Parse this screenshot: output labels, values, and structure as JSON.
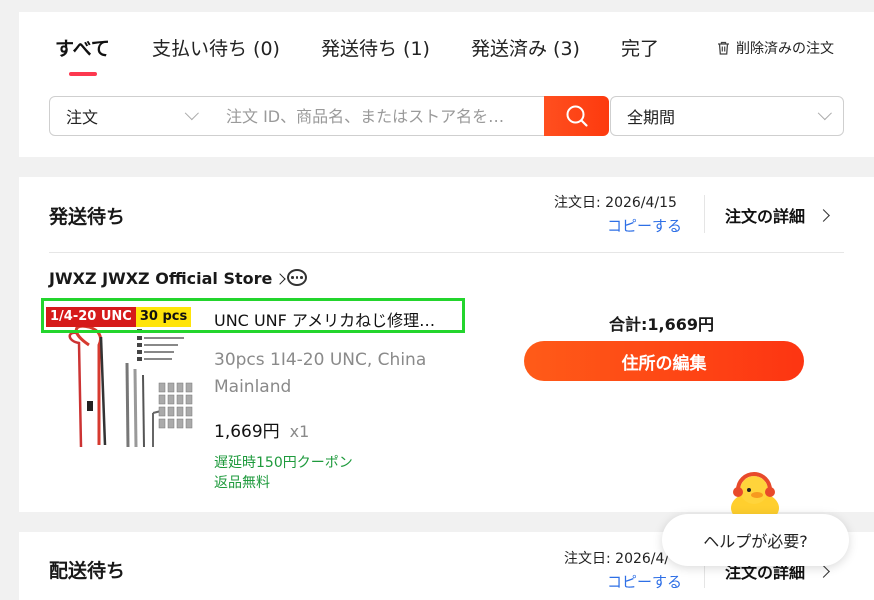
{
  "tabs": [
    {
      "label": "すべて"
    },
    {
      "label": "支払い待ち (0)"
    },
    {
      "label": "発送待ち (1)"
    },
    {
      "label": "発送済み (3)"
    },
    {
      "label": "完了"
    }
  ],
  "deleted_orders_label": "削除済みの注文",
  "search": {
    "type_value": "注文",
    "placeholder": "注文 ID、商品名、またはストア名を…",
    "period_value": "全期間"
  },
  "orders": [
    {
      "status": "発送待ち",
      "order_date": "注文日: 2026/4/15",
      "copy_label": "コピーする",
      "detail_label": "注文の詳細",
      "store_name": "JWXZ JWXZ Official Store",
      "product": {
        "badge_primary": "1/4-20 UNC",
        "badge_secondary": "30 pcs",
        "title": "UNC UNF アメリカねじ修理…",
        "variant": "30pcs 1I4-20 UNC, China Mainland",
        "price": "1,669円",
        "quantity": "x1",
        "perks": [
          "遅延時150円クーポン",
          "返品無料"
        ]
      },
      "total": "合計:1,669円",
      "action_label": "住所の編集"
    },
    {
      "status": "配送待ち",
      "order_date": "注文日: 2026/4/",
      "copy_label": "コピーする",
      "detail_label": "注文の詳細"
    }
  ],
  "help": {
    "label": "ヘルプが必要?"
  },
  "colors": {
    "accent_orange": "#fd3a0e",
    "tab_underline": "#fd384f",
    "link_blue": "#2e6fe6",
    "perk_green": "#1e9a3c",
    "highlight_green": "#23d52d"
  }
}
